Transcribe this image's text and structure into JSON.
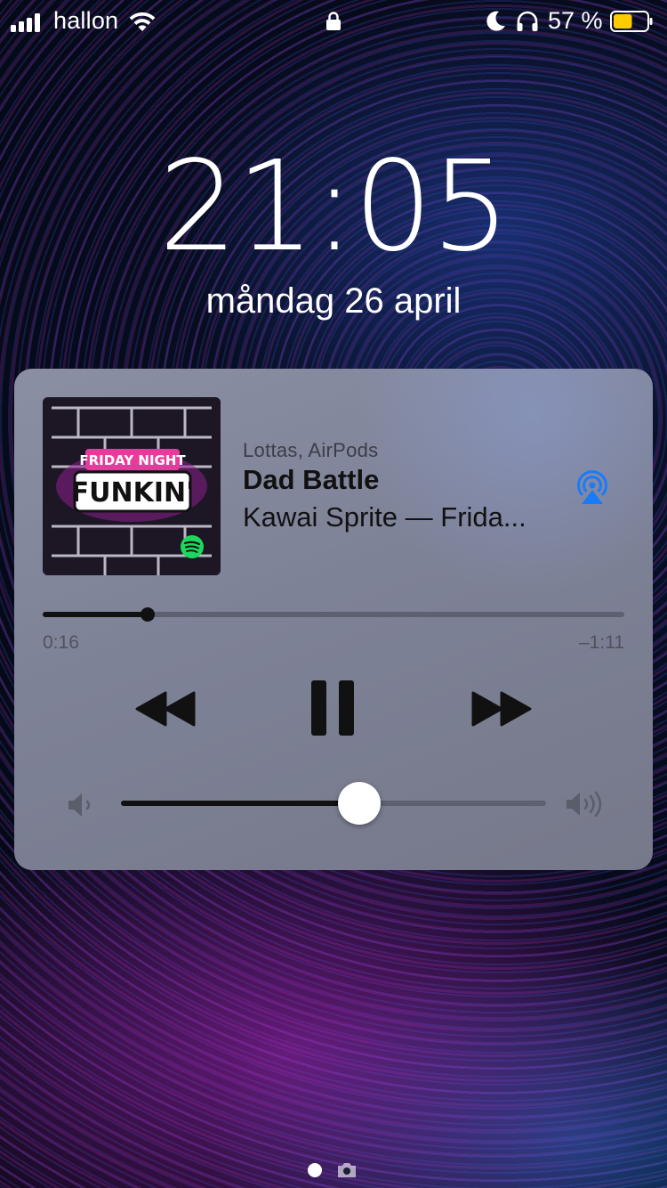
{
  "status_bar": {
    "carrier": "hallon",
    "signal_bars": 4,
    "battery_percent_label": "57 %",
    "battery_level": 0.57,
    "battery_color": "#ffcc00",
    "icons": [
      "signal-icon",
      "wifi-icon",
      "lock-icon",
      "moon-icon",
      "headphones-icon",
      "battery-icon"
    ]
  },
  "lock_screen": {
    "time": "21:05",
    "date": "måndag 26 april"
  },
  "now_playing": {
    "output_device": "Lottas, AirPods",
    "title": "Dad Battle",
    "artist_album": "Kawai Sprite — Frida...",
    "artwork_text": "FUNKIN'",
    "artwork_icon": "spotify-icon",
    "airplay_icon": "airplay-icon",
    "airplay_color": "#1a7cf5",
    "elapsed": "0:16",
    "remaining": "–1:11",
    "progress_fraction": 0.18,
    "volume_fraction": 0.56,
    "controls": {
      "rewind_icon": "rewind-icon",
      "pause_icon": "pause-icon",
      "forward_icon": "fast-forward-icon",
      "volume_low_icon": "volume-low-icon",
      "volume_high_icon": "volume-high-icon"
    }
  },
  "page_indicator": {
    "pages": [
      "dot",
      "camera-icon"
    ],
    "active": 0
  }
}
